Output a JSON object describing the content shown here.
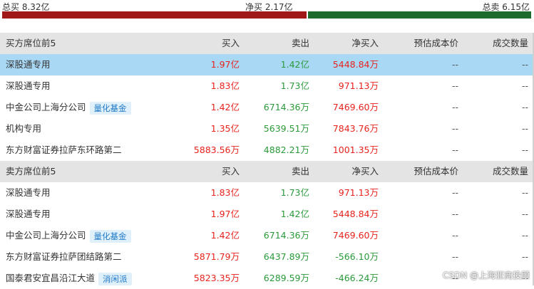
{
  "summary": {
    "total_buy": "总买 8.32亿",
    "net_buy": "净买 2.17亿",
    "total_sell": "总卖 6.15亿",
    "buy_color": "#a01818",
    "sell_color": "#1e6b2e"
  },
  "columns": [
    "买入",
    "卖出",
    "净买入",
    "预估成本价",
    "成交数量"
  ],
  "buy_section": {
    "title": "买方席位前5",
    "rows": [
      {
        "name": "深股通专用",
        "tag": "",
        "buy": "1.97亿",
        "sell": "1.42亿",
        "net": "5448.84万",
        "cost": "--",
        "vol": "--"
      },
      {
        "name": "深股通专用",
        "tag": "",
        "buy": "1.83亿",
        "sell": "1.73亿",
        "net": "971.13万",
        "cost": "--",
        "vol": "--"
      },
      {
        "name": "中金公司上海分公司",
        "tag": "量化基金",
        "buy": "1.42亿",
        "sell": "6714.36万",
        "net": "7469.60万",
        "cost": "--",
        "vol": "--"
      },
      {
        "name": "机构专用",
        "tag": "",
        "buy": "1.35亿",
        "sell": "5639.51万",
        "net": "7843.76万",
        "cost": "--",
        "vol": "--"
      },
      {
        "name": "东方财富证券拉萨东环路第二",
        "tag": "",
        "buy": "5883.56万",
        "sell": "4882.21万",
        "net": "1001.35万",
        "cost": "--",
        "vol": "--"
      }
    ]
  },
  "sell_section": {
    "title": "卖方席位前5",
    "rows": [
      {
        "name": "深股通专用",
        "tag": "",
        "buy": "1.83亿",
        "sell": "1.73亿",
        "net": "971.13万",
        "cost": "--",
        "vol": "--"
      },
      {
        "name": "深股通专用",
        "tag": "",
        "buy": "1.97亿",
        "sell": "1.42亿",
        "net": "5448.84万",
        "cost": "--",
        "vol": "--"
      },
      {
        "name": "中金公司上海分公司",
        "tag": "量化基金",
        "buy": "1.42亿",
        "sell": "6714.36万",
        "net": "7469.60万",
        "cost": "--",
        "vol": "--"
      },
      {
        "name": "东方财富证券拉萨团结路第二",
        "tag": "",
        "buy": "5871.79万",
        "sell": "6437.89万",
        "net": "-566.10万",
        "cost": "--",
        "vol": "--"
      },
      {
        "name": "国泰君安宜昌沿江大道",
        "tag": "消闲派",
        "buy": "5823.35万",
        "sell": "6289.59万",
        "net": "-466.24万",
        "cost": "--",
        "vol": "--"
      }
    ]
  },
  "watermark": "CSDN @上海亚商投顾"
}
